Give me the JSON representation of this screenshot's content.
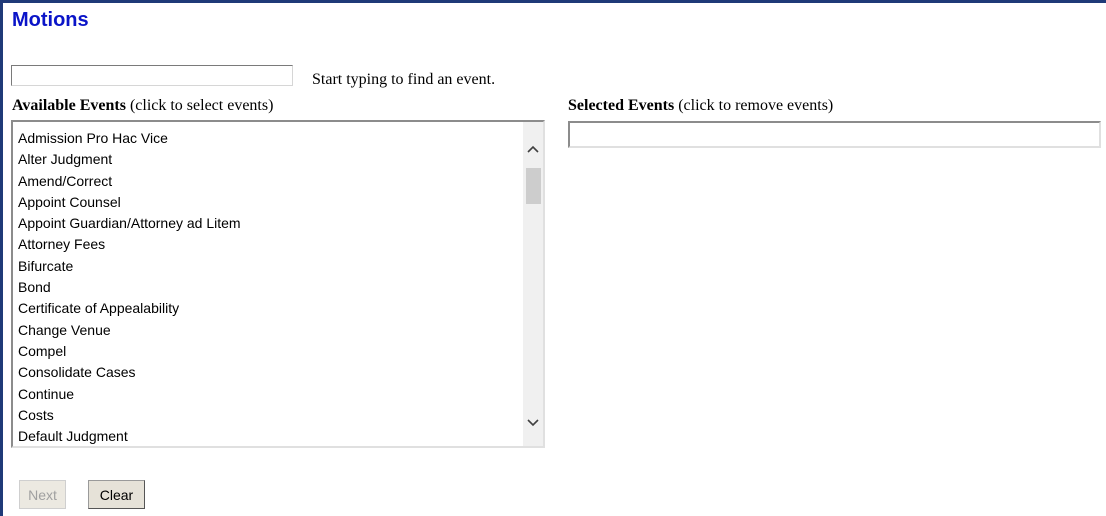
{
  "page": {
    "title": "Motions"
  },
  "search": {
    "value": "",
    "hint": "Start typing to find an event."
  },
  "available": {
    "header_bold": "Available Events",
    "header_note": "(click to select events)",
    "items": [
      "Admission Pro Hac Vice",
      "Alter Judgment",
      "Amend/Correct",
      "Appoint Counsel",
      "Appoint Guardian/Attorney ad Litem",
      "Attorney Fees",
      "Bifurcate",
      "Bond",
      "Certificate of Appealability",
      "Change Venue",
      "Compel",
      "Consolidate Cases",
      "Continue",
      "Costs",
      "Default Judgment"
    ]
  },
  "selected": {
    "header_bold": "Selected Events",
    "header_note": "(click to remove events)",
    "items": []
  },
  "buttons": {
    "next_label": "Next",
    "next_disabled": true,
    "clear_label": "Clear"
  },
  "icons": {
    "scroll_up": "chevron-up-icon",
    "scroll_down": "chevron-down-icon"
  },
  "colors": {
    "title": "#0a14c8",
    "frame": "#1f3a78"
  }
}
